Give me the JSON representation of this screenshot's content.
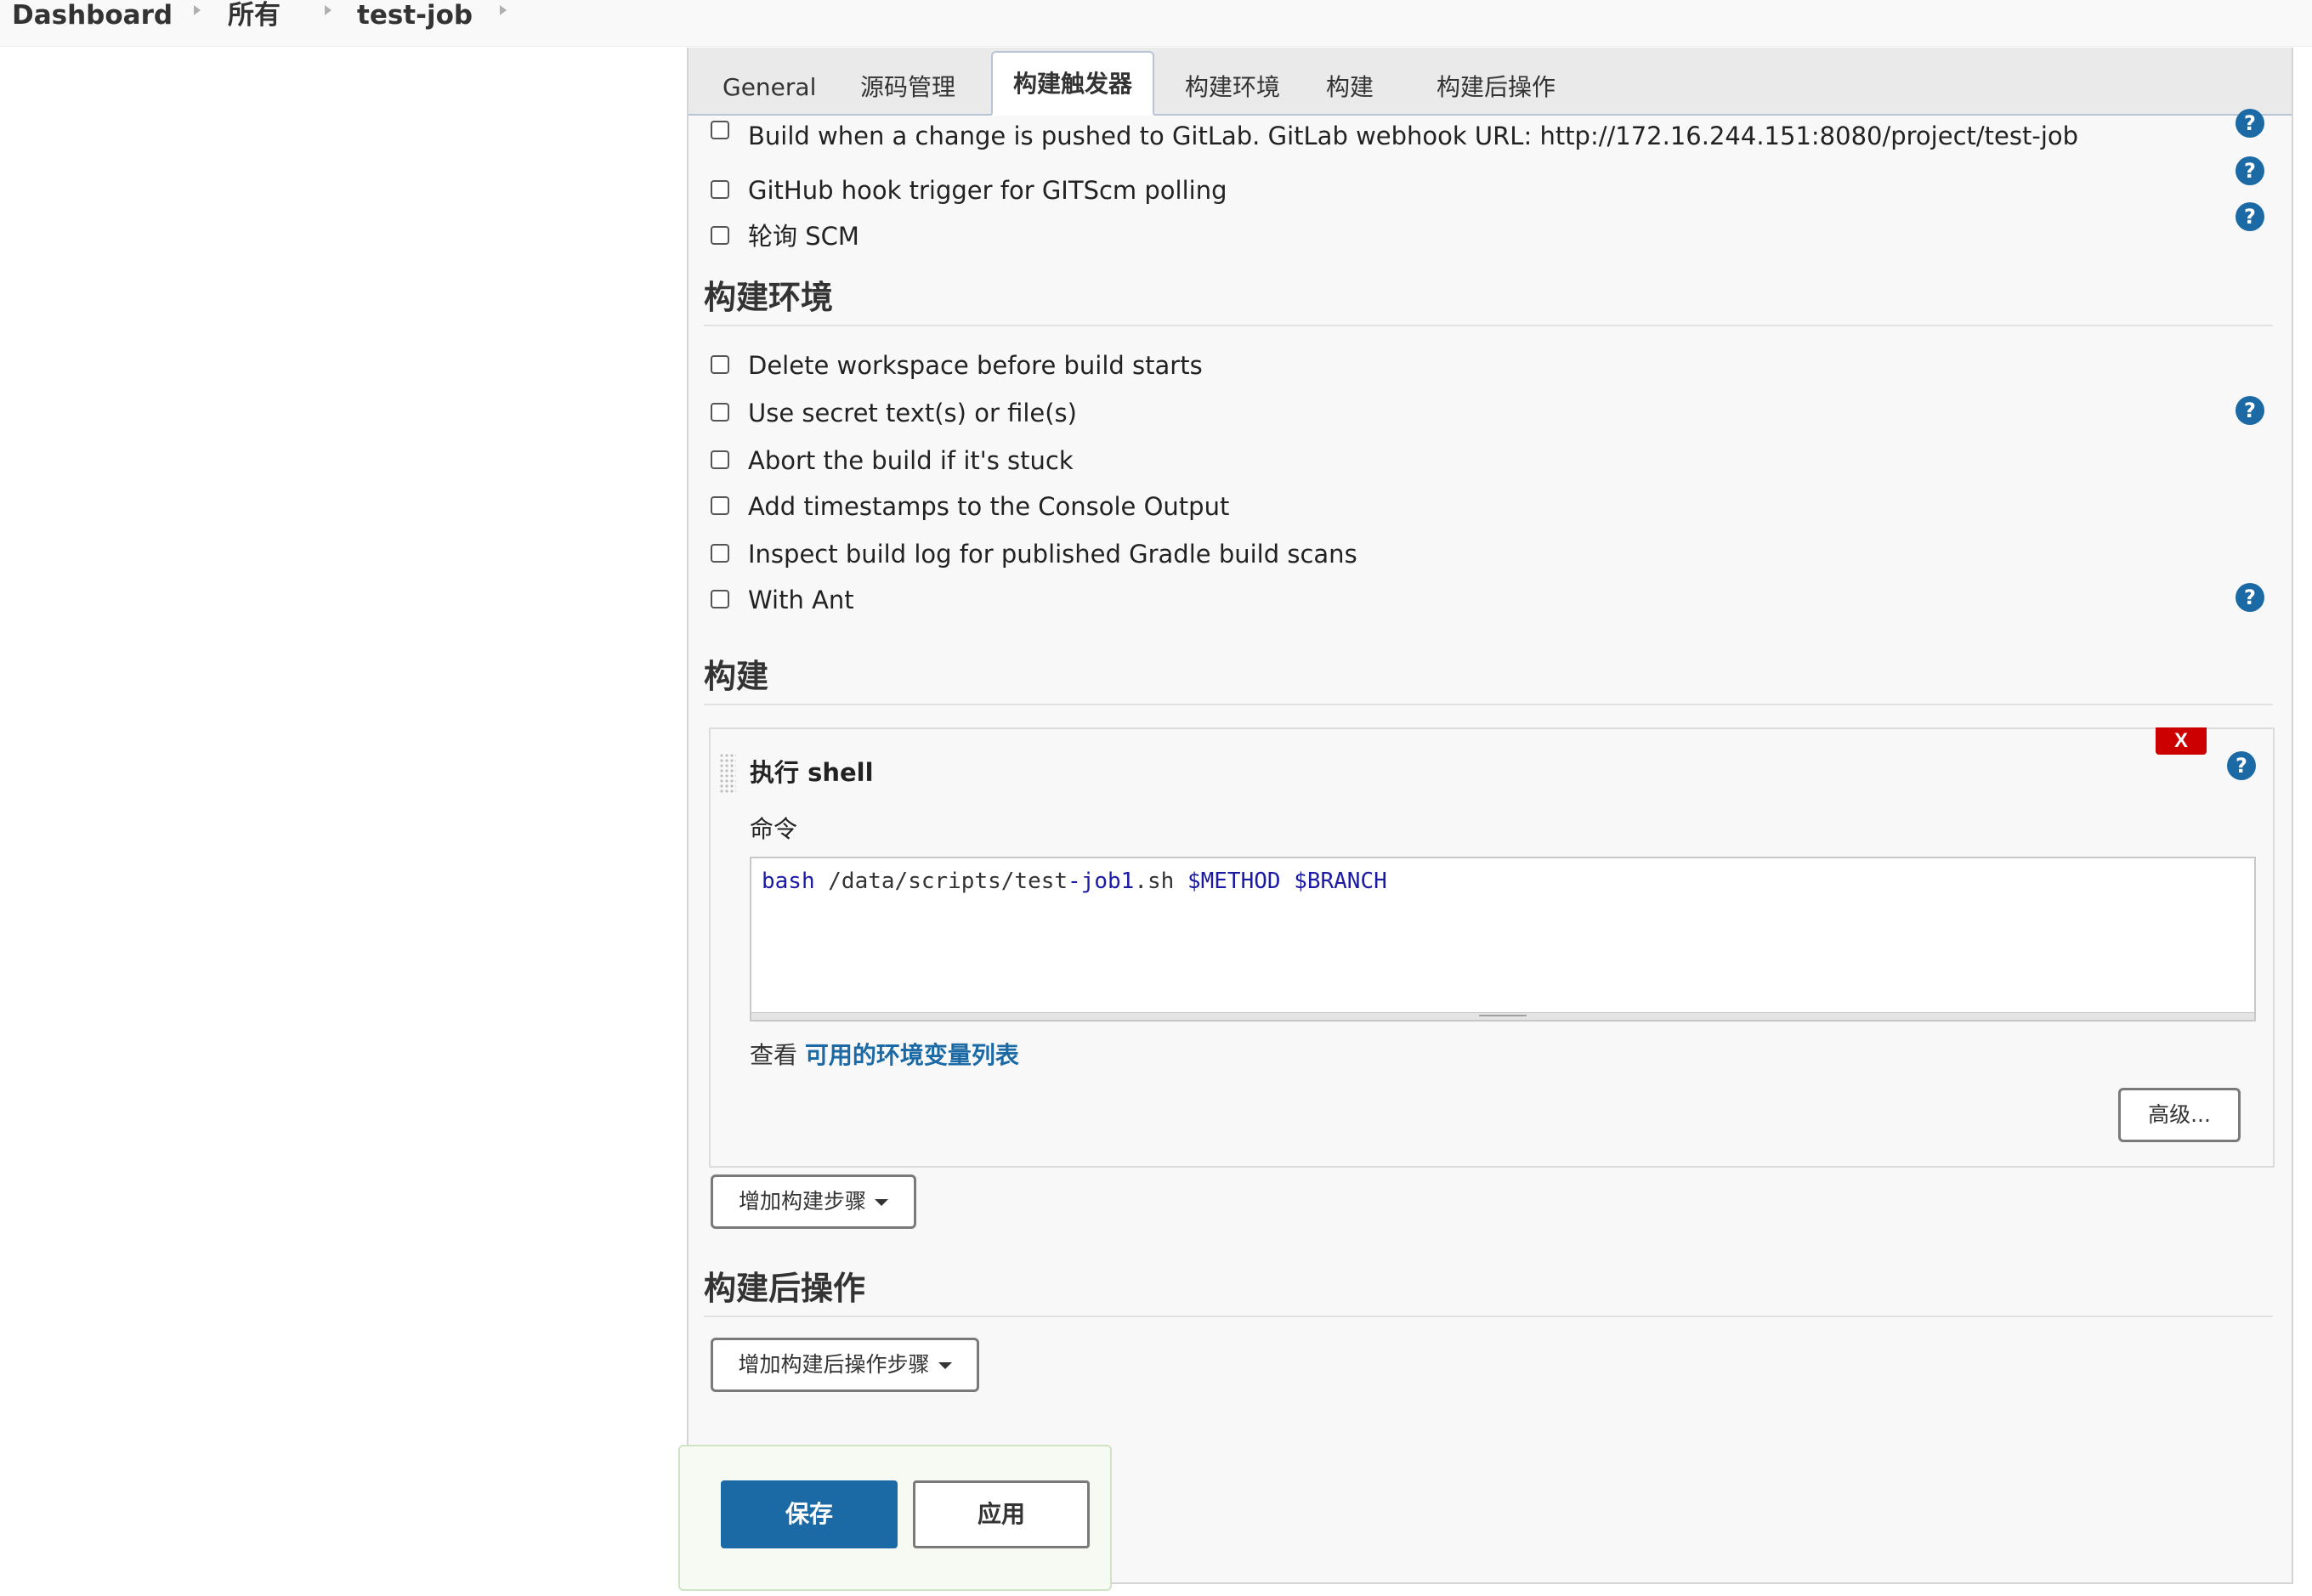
{
  "breadcrumb": {
    "items": [
      "Dashboard",
      "所有",
      "test-job"
    ]
  },
  "tabs": [
    "General",
    "源码管理",
    "构建触发器",
    "构建环境",
    "构建",
    "构建后操作"
  ],
  "active_tab": "构建触发器",
  "triggers": {
    "items": [
      {
        "label": "Build when a change is pushed to GitLab. GitLab webhook URL: http://172.16.244.151:8080/project/test-job",
        "checked": false,
        "help": true
      },
      {
        "label": "GitHub hook trigger for GITScm polling",
        "checked": false,
        "help": true
      },
      {
        "label": "轮询 SCM",
        "checked": false,
        "help": true
      }
    ]
  },
  "build_env": {
    "title": "构建环境",
    "items": [
      {
        "label": "Delete workspace before build starts",
        "checked": false,
        "help": false
      },
      {
        "label": "Use secret text(s) or file(s)",
        "checked": false,
        "help": true
      },
      {
        "label": "Abort the build if it's stuck",
        "checked": false,
        "help": false
      },
      {
        "label": "Add timestamps to the Console Output",
        "checked": false,
        "help": false
      },
      {
        "label": "Inspect build log for published Gradle build scans",
        "checked": false,
        "help": false
      },
      {
        "label": "With Ant",
        "checked": false,
        "help": true
      }
    ]
  },
  "build": {
    "title": "构建",
    "step": {
      "title": "执行 shell",
      "delete_label": "X",
      "command_label": "命令",
      "command": {
        "keyword": "bash",
        "path_a": " /data/scripts/test",
        "dash_token": "-job1",
        "path_b": ".sh ",
        "var1": "$METHOD",
        "space": " ",
        "var2": "$BRANCH"
      },
      "env_prefix": "查看 ",
      "env_link": "可用的环境变量列表",
      "advanced_label": "高级..."
    },
    "add_step_label": "增加构建步骤"
  },
  "post_build": {
    "title": "构建后操作",
    "add_step_label": "增加构建后操作步骤"
  },
  "actions": {
    "save_label": "保存",
    "apply_label": "应用"
  },
  "colors": {
    "accent": "#1b6aa5",
    "danger": "#cc0000"
  },
  "help_glyph": "?"
}
